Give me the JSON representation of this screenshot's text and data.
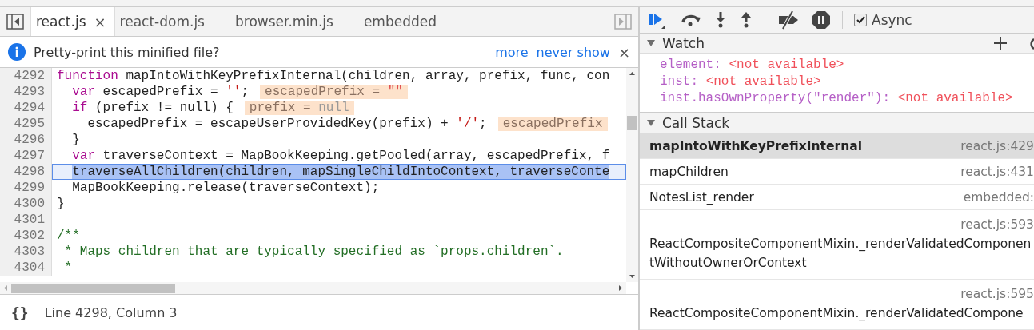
{
  "editor": {
    "tabs": [
      {
        "label": "react.js",
        "selected": true,
        "close": "×"
      },
      {
        "label": "react-dom.js",
        "selected": false
      },
      {
        "label": "browser.min.js",
        "selected": false
      },
      {
        "label": "embedded",
        "selected": false
      }
    ],
    "infobar": {
      "message": "Pretty-print this minified file?",
      "links": [
        "more",
        "never show"
      ],
      "close": "×"
    },
    "lines": [
      {
        "number": "4292",
        "selected": false,
        "tokens": [
          {
            "kind": "keyword",
            "text": "function"
          },
          {
            "kind": "plain",
            "text": " mapIntoWithKeyPrefixInternal(children, array, prefix, func, con"
          }
        ]
      },
      {
        "number": "4293",
        "selected": false,
        "tokens": [
          {
            "kind": "keyword",
            "text": "  var"
          },
          {
            "kind": "plain",
            "text": " escapedPrefix = "
          },
          {
            "kind": "string",
            "text": "''"
          },
          {
            "kind": "plain",
            "text": ";"
          },
          {
            "kind": "hint",
            "parts": [
              {
                "kind": "name",
                "text": "escapedPrefix = "
              },
              {
                "kind": "string",
                "text": "\"\""
              }
            ]
          }
        ]
      },
      {
        "number": "4294",
        "selected": false,
        "tokens": [
          {
            "kind": "keyword",
            "text": "  if"
          },
          {
            "kind": "plain",
            "text": " (prefix != null) {"
          },
          {
            "kind": "hint",
            "parts": [
              {
                "kind": "name",
                "text": "prefix = "
              },
              {
                "kind": "null",
                "text": "null"
              }
            ]
          }
        ]
      },
      {
        "number": "4295",
        "selected": false,
        "tokens": [
          {
            "kind": "plain",
            "text": "    escapedPrefix = escapeUserProvidedKey(prefix) + "
          },
          {
            "kind": "string",
            "text": "'/'"
          },
          {
            "kind": "plain",
            "text": ";"
          },
          {
            "kind": "hint",
            "parts": [
              {
                "kind": "name",
                "text": "escapedPrefix"
              }
            ]
          }
        ]
      },
      {
        "number": "4296",
        "selected": false,
        "tokens": [
          {
            "kind": "plain",
            "text": "  }"
          }
        ]
      },
      {
        "number": "4297",
        "selected": false,
        "tokens": [
          {
            "kind": "keyword",
            "text": "  var"
          },
          {
            "kind": "plain",
            "text": " traverseContext = MapBookKeeping.getPooled(array, escapedPrefix, f"
          }
        ]
      },
      {
        "number": "4298",
        "selected": true,
        "tokens": [
          {
            "kind": "selection",
            "text": "  traverseAllChildren(children, mapSingleChildIntoContext, traverseConte"
          }
        ]
      },
      {
        "number": "4299",
        "selected": false,
        "tokens": [
          {
            "kind": "plain",
            "text": "  MapBookKeeping.release(traverseContext);"
          }
        ]
      },
      {
        "number": "4300",
        "selected": false,
        "tokens": [
          {
            "kind": "plain",
            "text": "}"
          }
        ]
      },
      {
        "number": "4301",
        "selected": false
      },
      {
        "number": "4302",
        "selected": false,
        "tokens": [
          {
            "kind": "comment",
            "text": "/**"
          }
        ]
      },
      {
        "number": "4303",
        "selected": false,
        "tokens": [
          {
            "kind": "comment",
            "text": " * Maps children that are typically specified as `props.children`."
          }
        ]
      },
      {
        "number": "4304",
        "selected": false,
        "tokens": [
          {
            "kind": "comment",
            "text": " *"
          }
        ]
      }
    ],
    "status": {
      "format_button": "{}",
      "position": "Line 4298, Column 3"
    }
  },
  "debugger": {
    "async": {
      "label": "Async",
      "checked": true
    },
    "watch": {
      "title": "Watch",
      "expanded": true,
      "items": [
        {
          "name": "element:",
          "value": "<not available>"
        },
        {
          "name": "inst:",
          "value": "<not available>"
        },
        {
          "name": "inst.hasOwnProperty(\"render\"):",
          "value": "<not available>"
        }
      ]
    },
    "call_stack": {
      "title": "Call Stack",
      "expanded": true,
      "frames": [
        {
          "name": "mapIntoWithKeyPrefixInternal",
          "location": "react.js:429",
          "selected": true,
          "kind": "inline"
        },
        {
          "name": "mapChildren",
          "location": "react.js:431",
          "selected": false,
          "kind": "inline"
        },
        {
          "name": "NotesList_render",
          "location": "embedded:",
          "selected": false,
          "kind": "inline"
        },
        {
          "name": "ReactCompositeComponentMixin._renderValidatedComponentWithoutOwnerOrContext",
          "location": "react.js:593",
          "selected": false,
          "kind": "stacked"
        },
        {
          "name": "ReactCompositeComponentMixin._renderValidatedCompone",
          "location": "react.js:595",
          "selected": false,
          "kind": "stacked"
        }
      ]
    }
  }
}
